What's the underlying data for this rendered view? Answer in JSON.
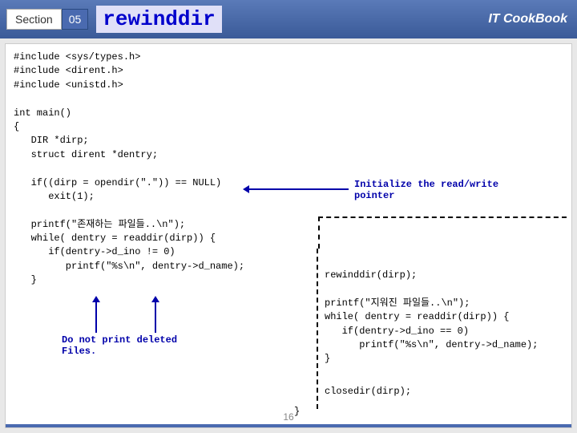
{
  "header": {
    "section_label": "Section",
    "section_num": "05",
    "title": "rewinddir",
    "brand": "IT CookBook"
  },
  "code": {
    "left": "#include <sys/types.h>\n#include <dirent.h>\n#include <unistd.h>\n\nint main()\n{\n   DIR *dirp;\n   struct dirent *dentry;\n\n   if((dirp = opendir(\".\")) == NULL)\n      exit(1);\n\n   printf(\"존재하는 파일들..\\n\");\n   while( dentry = readdir(dirp)) {\n      if(dentry->d_ino != 0)\n         printf(\"%s\\n\", dentry->d_name);\n   }",
    "right": "rewinddir(dirp);\n\nprintf(\"지워진 파일들..\\n\");\nwhile( dentry = readdir(dirp)) {\n   if(dentry->d_ino == 0)\n      printf(\"%s\\n\", dentry->d_name);\n}",
    "close": "closedir(dirp);",
    "brace": "}"
  },
  "annotations": {
    "init": "Initialize the read/write pointer",
    "deleted": "Do not print deleted Files."
  },
  "page": "16"
}
